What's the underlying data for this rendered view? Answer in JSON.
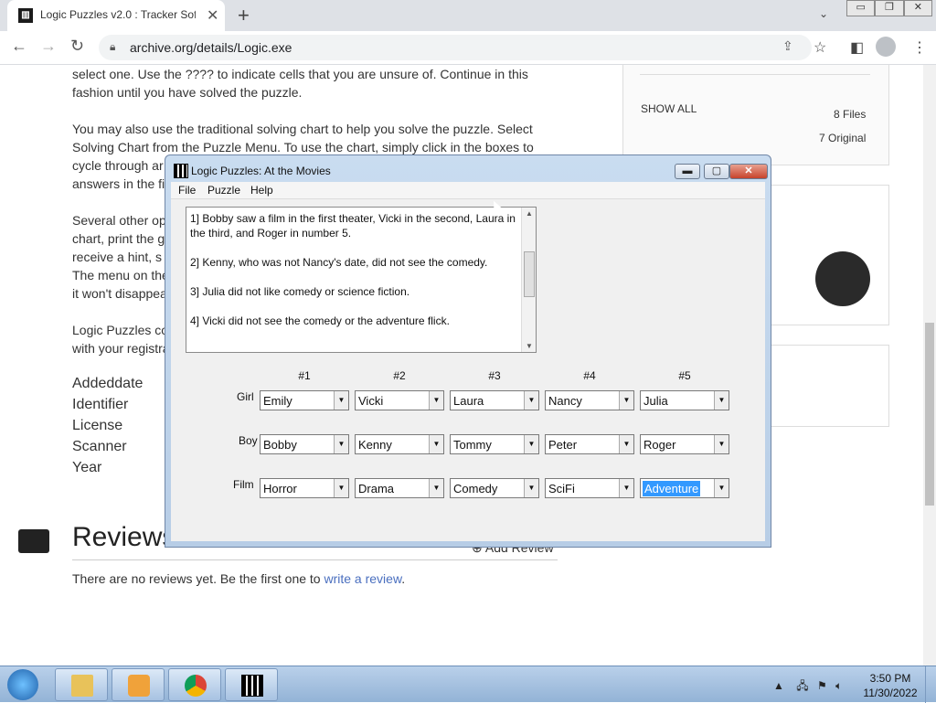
{
  "browser": {
    "tab_title": "Logic Puzzles v2.0 : Tracker Softw",
    "url": "archive.org/details/Logic.exe"
  },
  "page": {
    "para1": "select one. Use the ???? to indicate cells that you are unsure of. Continue in this fashion until you have solved the puzzle.",
    "para2": "You may also use the traditional solving chart to help you solve the puzzle. Select Solving Chart from the Puzzle Menu. To use the chart, simply click in the boxes to cycle through ar",
    "para2b": "answers in the fi",
    "para3a": "Several other op",
    "para3b": "chart, print the g",
    "para3c": "receive a hint, s",
    "para3d": "The menu on the",
    "para3e": "it won't disappea",
    "para4a": "Logic Puzzles co",
    "para4b": "with your registra",
    "meta_labels": [
      "Addeddate",
      "Identifier",
      "License",
      "Scanner",
      "Year"
    ],
    "sidebar": {
      "show_all": "SHOW ALL",
      "files": "8 Files",
      "original": "7 Original"
    },
    "reviews": {
      "heading": "Reviews",
      "add": "Add Review",
      "none_text": "There are no reviews yet. Be the first one to ",
      "link": "write a review",
      "period": "."
    }
  },
  "dialog": {
    "title": "Logic Puzzles: At the Movies",
    "menu": [
      "File",
      "Puzzle",
      "Help"
    ],
    "clues": [
      "1]  Bobby saw a film in the first theater, Vicki in the second, Laura in the third, and Roger in number 5.",
      "2]  Kenny, who was not Nancy's date, did not see the comedy.",
      "3]  Julia did not like comedy or science fiction.",
      "4]  Vicki did not see the comedy or the adventure flick."
    ],
    "columns": [
      "#1",
      "#2",
      "#3",
      "#4",
      "#5"
    ],
    "rows": [
      {
        "label": "Girl",
        "values": [
          "Emily",
          "Vicki",
          "Laura",
          "Nancy",
          "Julia"
        ]
      },
      {
        "label": "Boy",
        "values": [
          "Bobby",
          "Kenny",
          "Tommy",
          "Peter",
          "Roger"
        ]
      },
      {
        "label": "Film",
        "values": [
          "Horror",
          "Drama",
          "Comedy",
          "SciFi",
          "Adventure"
        ]
      }
    ]
  },
  "taskbar": {
    "time": "3:50 PM",
    "date": "11/30/2022"
  }
}
